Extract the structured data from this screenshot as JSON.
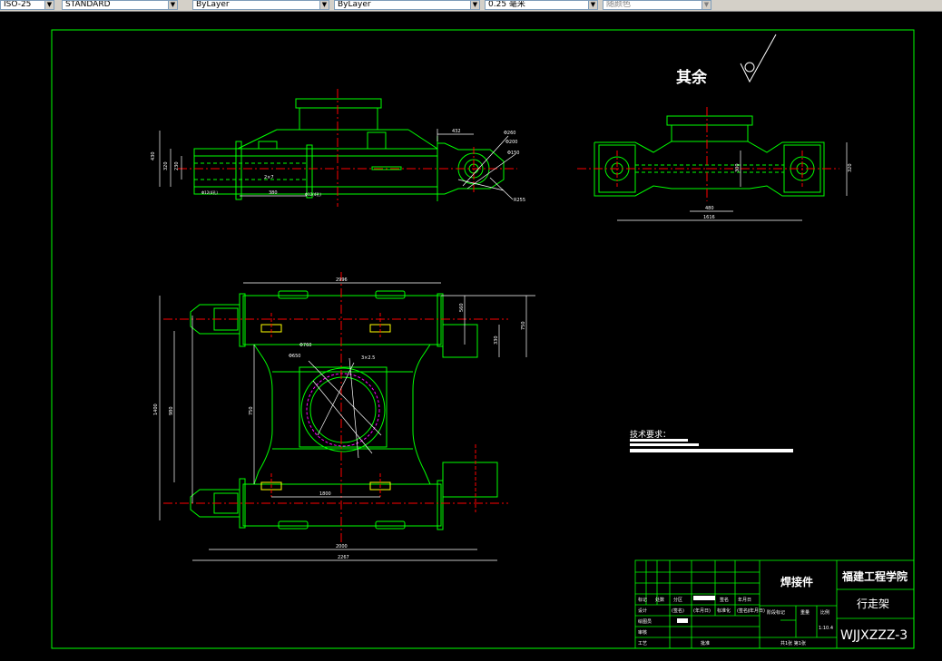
{
  "toolbar": {
    "fields": [
      {
        "value": "ISO-25",
        "color": "#000"
      },
      {
        "value": "STANDARD",
        "color": "#000"
      },
      {
        "value": "ByLayer",
        "color": "#000"
      },
      {
        "value": "ByLayer",
        "color": "#000"
      },
      {
        "value": "0.25 毫米",
        "color": "#000"
      },
      {
        "value": "随颜色",
        "color": "#808080"
      }
    ]
  },
  "drawing": {
    "surface_mark_label": "其余",
    "tech_requirements_title": "技术要求：",
    "top_view_dims": {
      "overall_width": "2996",
      "total_length": "2267",
      "inner_length": "2000",
      "spacing": "1800",
      "height_left": "1400",
      "height_inner": "980",
      "height_mid": "750",
      "right_h1": "560",
      "right_h2": "750",
      "right_h3": "330",
      "bore_dia": "Φ760",
      "bore_dia2": "Φ650",
      "bolt_spec": "3×2.5"
    },
    "front_view_dims": {
      "lug_len": "432",
      "d1": "Φ260",
      "d2": "Φ200",
      "d3": "Φ150",
      "d4": "R255",
      "h1": "430",
      "h2": "320",
      "h3": "230",
      "span": "380",
      "hole_left": "Φ12(4孔)",
      "hole_right": "Φ12(4孔)",
      "weld": "2×7"
    },
    "side_view_dims": {
      "height": "320",
      "inner": "300",
      "w1": "480",
      "w2": "1616"
    },
    "title_block": {
      "part_type": "焊接件",
      "school": "福建工程学院",
      "part_name": "行走架",
      "drawing_no": "WJJXZZZ-3",
      "scale": "1:10.4",
      "row_labels": [
        "标记",
        "处数",
        "分区",
        "更改文件号",
        "签名",
        "年月日"
      ],
      "design_row": [
        "设计",
        "(签名)",
        "(年月日)",
        "标准化",
        "(签名)",
        "(年月日)"
      ],
      "check_label": "审核",
      "process_label": "工艺",
      "approve_label": "批准",
      "stage_label": "阶段标记",
      "weight_label": "重量",
      "ratio_label": "比例",
      "sheet_label": "共1张 第1张",
      "drafter_label": "绘图员"
    }
  },
  "colors": {
    "frame": "#00ff00",
    "centerline": "#ff0000",
    "dimension": "#ffffff",
    "inner_circle": "#ff00ff",
    "background": "#000000"
  }
}
